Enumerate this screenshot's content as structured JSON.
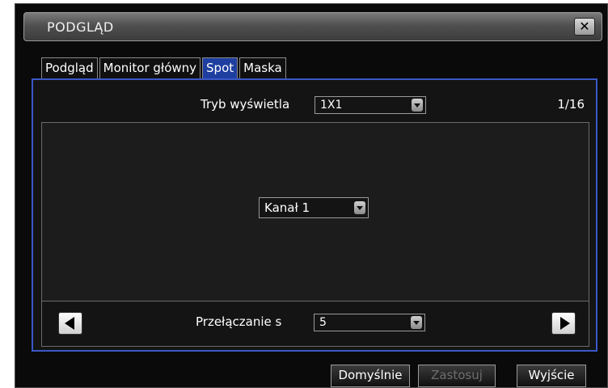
{
  "window": {
    "title": "PODGLĄD",
    "close_icon": "close-icon"
  },
  "tabs": [
    {
      "label": "Podgląd",
      "active": false
    },
    {
      "label": "Monitor główny",
      "active": false
    },
    {
      "label": "Spot",
      "active": true
    },
    {
      "label": "Maska",
      "active": false
    }
  ],
  "display_mode": {
    "label": "Tryb wyświetla",
    "value": "1X1"
  },
  "page_indicator": "1/16",
  "channel_select": {
    "value": "Kanał 1"
  },
  "switching": {
    "label": "Przełączanie s",
    "value": "5"
  },
  "buttons": {
    "default": "Domyślnie",
    "apply": "Zastosuj",
    "exit": "Wyjście"
  },
  "colors": {
    "accent": "#3a58c8",
    "active_tab": "#1e3ea0",
    "background": "#0a0a0a"
  }
}
